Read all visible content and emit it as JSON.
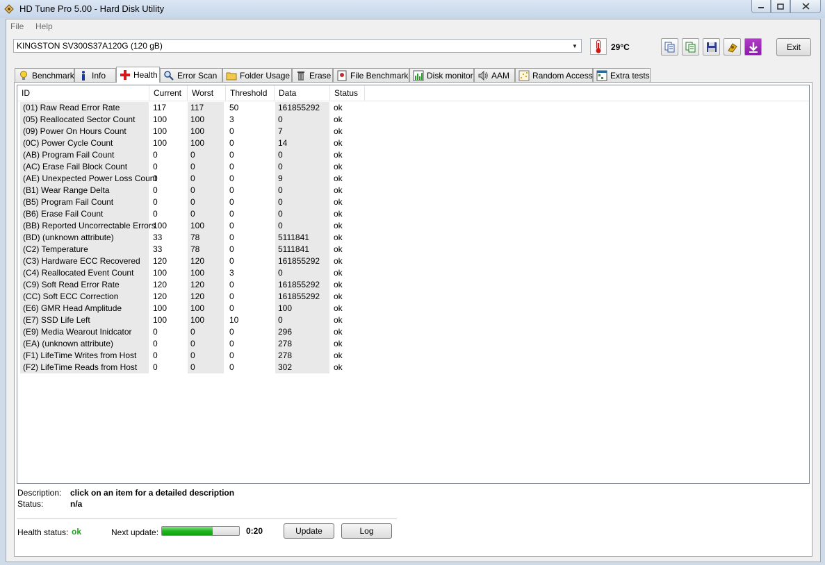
{
  "window": {
    "title": "HD Tune Pro 5.00 - Hard Disk Utility",
    "minimize": "▭",
    "maximize": "▢",
    "close": "✕"
  },
  "menu": {
    "file": "File",
    "help": "Help"
  },
  "toolbar": {
    "drive": "KINGSTON SV300S37A120G (120 gB)",
    "temperature": "29°C",
    "exit_label": "Exit",
    "buttons": [
      "copy-icon",
      "copy-all-icon",
      "save-icon",
      "options-icon",
      "download-icon"
    ]
  },
  "tabs": [
    {
      "label": "Benchmark",
      "icon": "benchmark-icon"
    },
    {
      "label": "Info",
      "icon": "info-icon"
    },
    {
      "label": "Health",
      "icon": "health-icon",
      "active": true
    },
    {
      "label": "Error Scan",
      "icon": "error-scan-icon"
    },
    {
      "label": "Folder Usage",
      "icon": "folder-icon"
    },
    {
      "label": "Erase",
      "icon": "erase-icon"
    },
    {
      "label": "File Benchmark",
      "icon": "file-benchmark-icon"
    },
    {
      "label": "Disk monitor",
      "icon": "disk-monitor-icon"
    },
    {
      "label": "AAM",
      "icon": "speaker-icon"
    },
    {
      "label": "Random Access",
      "icon": "random-access-icon"
    },
    {
      "label": "Extra tests",
      "icon": "extra-tests-icon"
    }
  ],
  "smart": {
    "columns": [
      "ID",
      "Current",
      "Worst",
      "Threshold",
      "Data",
      "Status"
    ],
    "rows": [
      [
        "(01) Raw Read Error Rate",
        "117",
        "117",
        "50",
        "161855292",
        "ok"
      ],
      [
        "(05) Reallocated Sector Count",
        "100",
        "100",
        "3",
        "0",
        "ok"
      ],
      [
        "(09) Power On Hours Count",
        "100",
        "100",
        "0",
        "7",
        "ok"
      ],
      [
        "(0C) Power Cycle Count",
        "100",
        "100",
        "0",
        "14",
        "ok"
      ],
      [
        "(AB) Program Fail Count",
        "0",
        "0",
        "0",
        "0",
        "ok"
      ],
      [
        "(AC) Erase Fail Block Count",
        "0",
        "0",
        "0",
        "0",
        "ok"
      ],
      [
        "(AE) Unexpected Power Loss Count",
        "0",
        "0",
        "0",
        "9",
        "ok"
      ],
      [
        "(B1) Wear Range Delta",
        "0",
        "0",
        "0",
        "0",
        "ok"
      ],
      [
        "(B5) Program Fail Count",
        "0",
        "0",
        "0",
        "0",
        "ok"
      ],
      [
        "(B6) Erase Fail Count",
        "0",
        "0",
        "0",
        "0",
        "ok"
      ],
      [
        "(BB) Reported Uncorrectable Errors",
        "100",
        "100",
        "0",
        "0",
        "ok"
      ],
      [
        "(BD) (unknown attribute)",
        "33",
        "78",
        "0",
        "5111841",
        "ok"
      ],
      [
        "(C2) Temperature",
        "33",
        "78",
        "0",
        "5111841",
        "ok"
      ],
      [
        "(C3) Hardware ECC Recovered",
        "120",
        "120",
        "0",
        "161855292",
        "ok"
      ],
      [
        "(C4) Reallocated Event Count",
        "100",
        "100",
        "3",
        "0",
        "ok"
      ],
      [
        "(C9) Soft Read Error Rate",
        "120",
        "120",
        "0",
        "161855292",
        "ok"
      ],
      [
        "(CC) Soft ECC Correction",
        "120",
        "120",
        "0",
        "161855292",
        "ok"
      ],
      [
        "(E6) GMR Head Amplitude",
        "100",
        "100",
        "0",
        "100",
        "ok"
      ],
      [
        "(E7) SSD Life Left",
        "100",
        "100",
        "10",
        "0",
        "ok"
      ],
      [
        "(E9) Media Wearout Inidcator",
        "0",
        "0",
        "0",
        "296",
        "ok"
      ],
      [
        "(EA) (unknown attribute)",
        "0",
        "0",
        "0",
        "278",
        "ok"
      ],
      [
        "(F1) LifeTime Writes from Host",
        "0",
        "0",
        "0",
        "278",
        "ok"
      ],
      [
        "(F2) LifeTime Reads from Host",
        "0",
        "0",
        "0",
        "302",
        "ok"
      ]
    ]
  },
  "details": {
    "description_label": "Description:",
    "description_value": "click on an item for a detailed description",
    "status_label": "Status:",
    "status_value": "n/a"
  },
  "footer": {
    "health_label": "Health status:",
    "health_value": "ok",
    "next_update_label": "Next update:",
    "progress_fraction": 0.66,
    "timer": "0:20",
    "update_label": "Update",
    "log_label": "Log"
  },
  "colors": {
    "ok_green": "#21a121",
    "progress_green": "#1fb71f"
  }
}
